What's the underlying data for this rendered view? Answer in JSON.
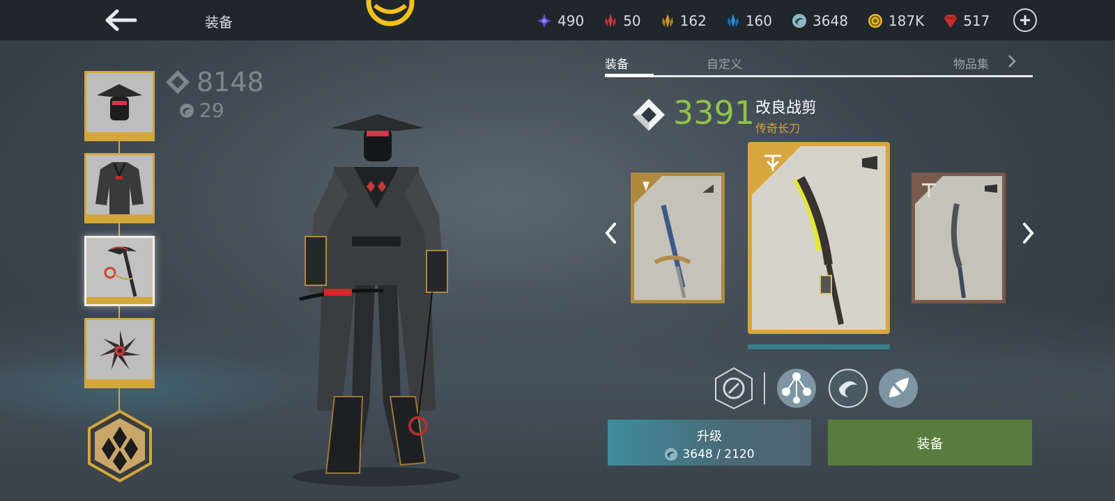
{
  "header": {
    "title": "装备",
    "currencies": [
      {
        "icon": "purple-star-gem-icon",
        "value": "490",
        "color": "#5a4fcf"
      },
      {
        "icon": "red-crystal-icon",
        "value": "50",
        "color": "#d33a3a"
      },
      {
        "icon": "gold-crystal-icon",
        "value": "162",
        "color": "#d39a2a"
      },
      {
        "icon": "blue-crystal-icon",
        "value": "160",
        "color": "#2e8ad8"
      },
      {
        "icon": "spirit-orb-icon",
        "value": "3648",
        "color": "#8fb8c4"
      },
      {
        "icon": "gold-coin-icon",
        "value": "187K",
        "color": "#e5b82a"
      },
      {
        "icon": "ruby-gem-icon",
        "value": "517",
        "color": "#cc2d2d"
      }
    ]
  },
  "character_stats": {
    "power": "8148",
    "level": "29"
  },
  "slots": [
    {
      "name": "helmet",
      "active": false
    },
    {
      "name": "armor",
      "active": false
    },
    {
      "name": "weapon",
      "active": true
    },
    {
      "name": "ranged",
      "active": false
    }
  ],
  "tabs": [
    {
      "label": "装备",
      "active": true
    },
    {
      "label": "自定义",
      "active": false
    },
    {
      "label": "物品集",
      "active": false
    }
  ],
  "item": {
    "power": "3391",
    "name": "改良战剪",
    "type": "传奇长刀"
  },
  "buttons": {
    "upgrade_label": "升级",
    "upgrade_cost": "3648 / 2120",
    "equip_label": "装备"
  },
  "colors": {
    "accent_gold": "#d4a73a",
    "power_green": "#8fc34a",
    "equip_green": "#587c3e",
    "upgrade_teal": "#3e8d9e"
  }
}
